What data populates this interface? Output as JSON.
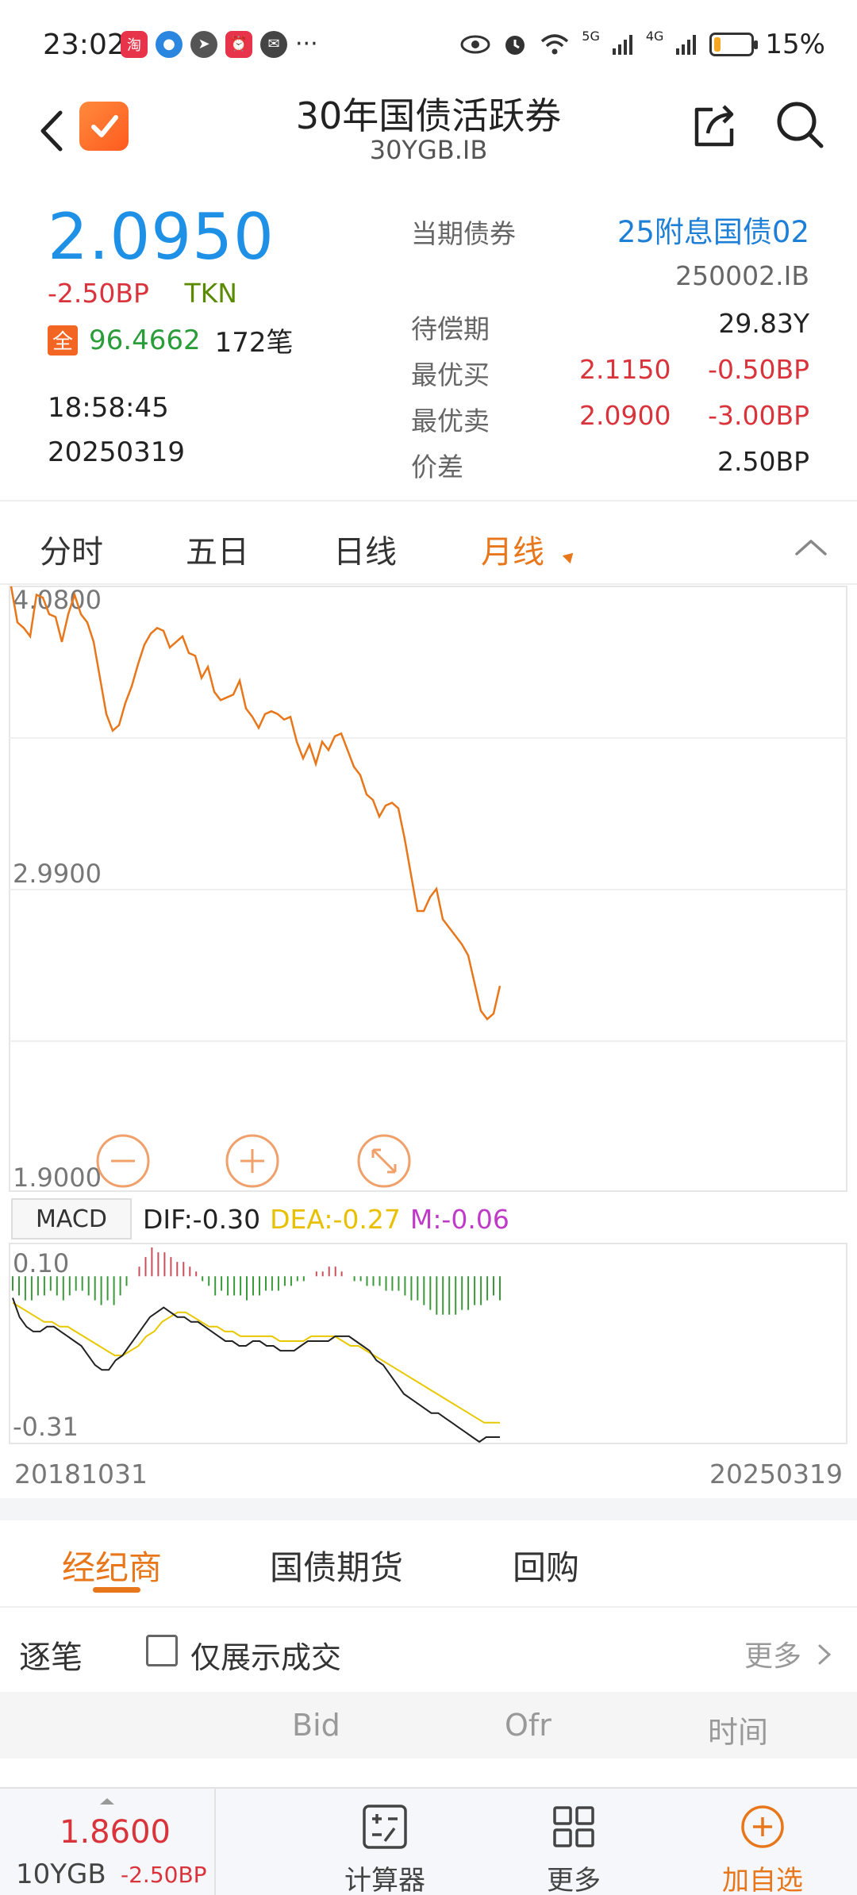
{
  "status_bar": {
    "time": "23:02",
    "more_dots": "···",
    "signal_5g": "5G",
    "signal_4g": "4G",
    "battery_text": "15%",
    "battery_level": 0.15
  },
  "header": {
    "title": "30年国债活跃券",
    "code": "30YGB.IB"
  },
  "quote": {
    "price": "2.0950",
    "change_bp": "-2.50BP",
    "source": "TKN",
    "full_badge": "全",
    "full_price": "96.4662",
    "trade_count": "172笔",
    "time": "18:58:45",
    "date": "20250319"
  },
  "info": {
    "current_bond_label": "当期债券",
    "current_bond_name": "25附息国债02",
    "current_bond_code": "250002.IB",
    "maturity_label": "待偿期",
    "maturity_value": "29.83Y",
    "best_bid_label": "最优买",
    "best_bid_price": "2.1150",
    "best_bid_change": "-0.50BP",
    "best_ask_label": "最优卖",
    "best_ask_price": "2.0900",
    "best_ask_change": "-3.00BP",
    "spread_label": "价差",
    "spread_value": "2.50BP"
  },
  "chart_tabs": [
    "分时",
    "五日",
    "日线",
    "月线"
  ],
  "active_chart_tab": "月线",
  "chart_data": [
    {
      "type": "line",
      "series": [
        {
          "values": [
            4.08,
            3.95,
            3.93,
            3.9,
            4.05,
            4.04,
            3.98,
            3.97,
            3.88,
            3.98,
            4.05,
            3.98,
            3.95,
            3.88,
            3.75,
            3.62,
            3.56,
            3.58,
            3.66,
            3.72,
            3.8,
            3.87,
            3.91,
            3.93,
            3.92,
            3.86,
            3.88,
            3.9,
            3.84,
            3.83,
            3.75,
            3.79,
            3.7,
            3.67,
            3.68,
            3.69,
            3.74,
            3.64,
            3.61,
            3.57,
            3.62,
            3.63,
            3.62,
            3.6,
            3.61,
            3.52,
            3.46,
            3.51,
            3.44,
            3.52,
            3.49,
            3.54,
            3.55,
            3.49,
            3.43,
            3.4,
            3.33,
            3.31,
            3.25,
            3.29,
            3.3,
            3.28,
            3.17,
            3.04,
            2.91,
            2.91,
            2.96,
            2.99,
            2.88,
            2.85,
            2.82,
            2.79,
            2.75,
            2.65,
            2.55,
            2.52,
            2.54,
            2.64
          ]
        }
      ],
      "y_ticks": [
        "4.0800",
        "2.9900",
        "1.9000"
      ],
      "ylim": [
        1.9,
        4.08
      ],
      "x_start": "20181031",
      "x_end": "20250319"
    },
    {
      "type": "bar",
      "title": "MACD",
      "dif_label": "DIF:-0.30",
      "dea_label": "DEA:-0.27",
      "m_label": "M:-0.06",
      "y_ticks": [
        "0.10",
        "-0.31"
      ],
      "ylim": [
        -0.31,
        0.1
      ],
      "histogram": [
        -0.03,
        -0.04,
        -0.05,
        -0.05,
        -0.04,
        -0.04,
        -0.03,
        -0.04,
        -0.05,
        -0.04,
        -0.03,
        -0.03,
        -0.04,
        -0.05,
        -0.06,
        -0.05,
        -0.06,
        -0.04,
        -0.02,
        0.0,
        0.02,
        0.04,
        0.06,
        0.05,
        0.05,
        0.04,
        0.03,
        0.03,
        0.02,
        0.01,
        -0.01,
        -0.02,
        -0.04,
        -0.03,
        -0.04,
        -0.04,
        -0.04,
        -0.05,
        -0.04,
        -0.04,
        -0.03,
        -0.03,
        -0.03,
        -0.02,
        -0.02,
        -0.01,
        -0.01,
        0.0,
        0.01,
        0.01,
        0.02,
        0.02,
        0.01,
        0.0,
        -0.01,
        -0.01,
        -0.02,
        -0.02,
        -0.02,
        -0.03,
        -0.03,
        -0.03,
        -0.04,
        -0.05,
        -0.05,
        -0.06,
        -0.07,
        -0.08,
        -0.08,
        -0.08,
        -0.08,
        -0.07,
        -0.07,
        -0.06,
        -0.06,
        -0.05,
        -0.04,
        -0.05
      ],
      "dif": [
        -0.01,
        -0.05,
        -0.07,
        -0.08,
        -0.08,
        -0.07,
        -0.07,
        -0.08,
        -0.09,
        -0.1,
        -0.11,
        -0.13,
        -0.15,
        -0.16,
        -0.16,
        -0.14,
        -0.13,
        -0.11,
        -0.09,
        -0.07,
        -0.05,
        -0.04,
        -0.03,
        -0.04,
        -0.05,
        -0.05,
        -0.06,
        -0.06,
        -0.07,
        -0.08,
        -0.09,
        -0.1,
        -0.1,
        -0.11,
        -0.11,
        -0.1,
        -0.1,
        -0.11,
        -0.11,
        -0.12,
        -0.12,
        -0.12,
        -0.11,
        -0.1,
        -0.1,
        -0.1,
        -0.1,
        -0.09,
        -0.09,
        -0.09,
        -0.1,
        -0.11,
        -0.12,
        -0.14,
        -0.15,
        -0.17,
        -0.19,
        -0.21,
        -0.22,
        -0.23,
        -0.24,
        -0.25,
        -0.25,
        -0.26,
        -0.27,
        -0.28,
        -0.29,
        -0.3,
        -0.31,
        -0.3,
        -0.3,
        -0.3
      ],
      "dea": [
        -0.02,
        -0.03,
        -0.04,
        -0.05,
        -0.06,
        -0.06,
        -0.07,
        -0.07,
        -0.08,
        -0.09,
        -0.1,
        -0.11,
        -0.12,
        -0.13,
        -0.13,
        -0.12,
        -0.11,
        -0.09,
        -0.08,
        -0.06,
        -0.05,
        -0.04,
        -0.04,
        -0.05,
        -0.06,
        -0.07,
        -0.07,
        -0.08,
        -0.08,
        -0.09,
        -0.09,
        -0.09,
        -0.09,
        -0.09,
        -0.1,
        -0.1,
        -0.1,
        -0.1,
        -0.09,
        -0.09,
        -0.09,
        -0.09,
        -0.1,
        -0.11,
        -0.11,
        -0.12,
        -0.13,
        -0.14,
        -0.15,
        -0.16,
        -0.17,
        -0.18,
        -0.19,
        -0.2,
        -0.21,
        -0.22,
        -0.23,
        -0.24,
        -0.25,
        -0.26,
        -0.27,
        -0.27,
        -0.27
      ]
    }
  ],
  "macd": {
    "label": "MACD"
  },
  "broker_tabs": [
    "经纪商",
    "国债期货",
    "回购"
  ],
  "active_broker_tab": "经纪商",
  "trades": {
    "title": "逐笔",
    "only_deals_label": "仅展示成交",
    "only_deals_checked": false,
    "more_label": "更多",
    "columns": [
      "Bid",
      "Ofr",
      "时间"
    ]
  },
  "bottom_bar": {
    "mini_price": "1.8600",
    "mini_name": "10YGB",
    "mini_change": "-2.50BP",
    "calculator": "计算器",
    "more": "更多",
    "add_watchlist": "加自选"
  },
  "colors": {
    "accent": "#e8761a",
    "price_blue": "#1e90e6",
    "up_red": "#d9343b",
    "down_green": "#2a9d3a"
  }
}
